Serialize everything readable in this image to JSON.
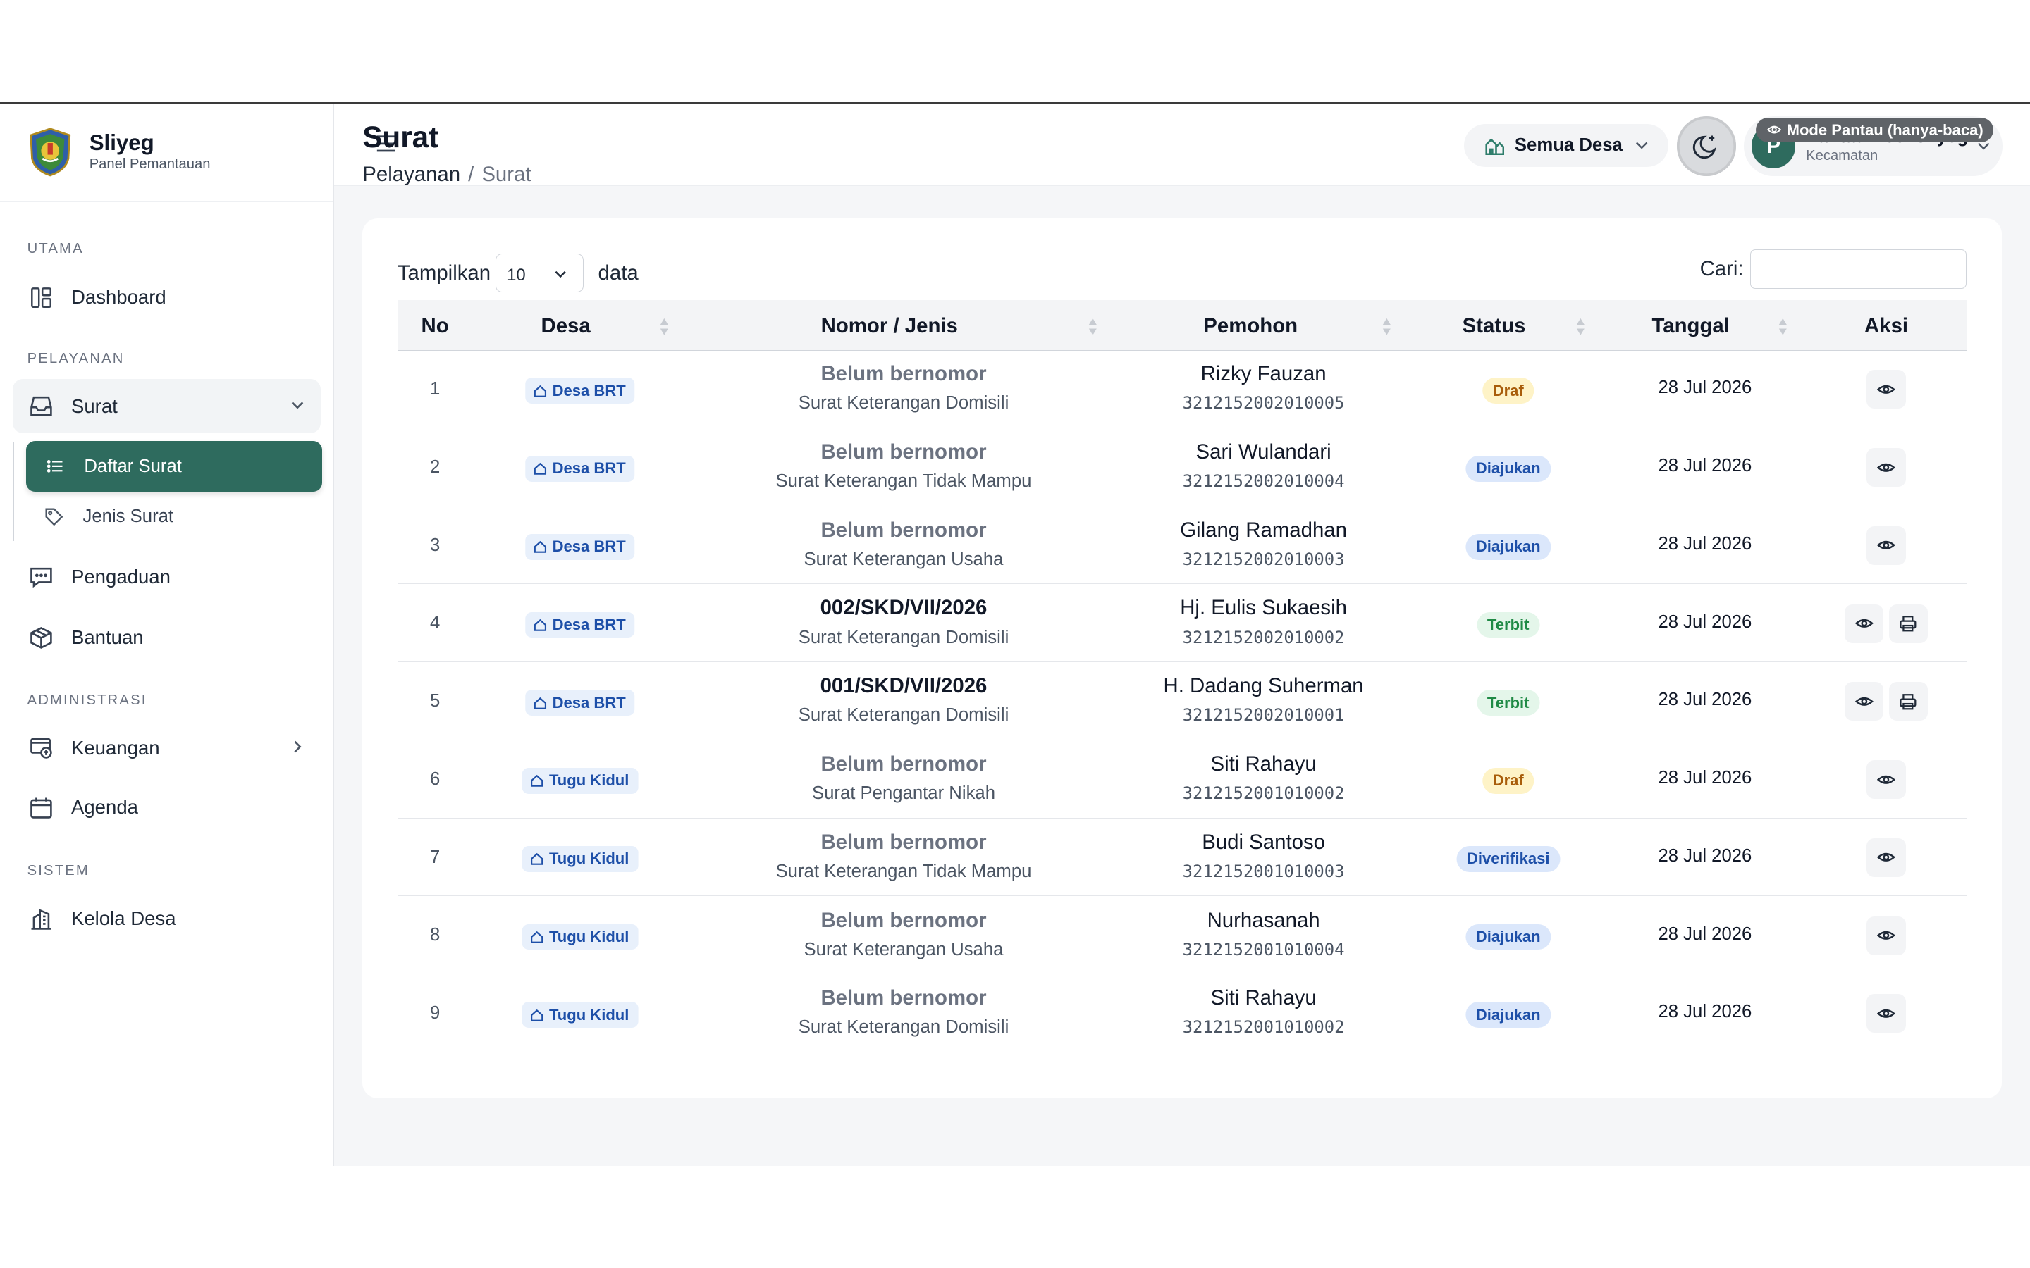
{
  "brand": {
    "name": "Sliyeg",
    "subtitle": "Panel Pemantauan"
  },
  "sidebar": {
    "sections": {
      "utama": "UTAMA",
      "pelayanan": "PELAYANAN",
      "administrasi": "ADMINISTRASI",
      "sistem": "SISTEM"
    },
    "items": {
      "dashboard": "Dashboard",
      "surat": "Surat",
      "daftar_surat": "Daftar Surat",
      "jenis_surat": "Jenis Surat",
      "pengaduan": "Pengaduan",
      "bantuan": "Bantuan",
      "keuangan": "Keuangan",
      "agenda": "Agenda",
      "kelola_desa": "Kelola Desa"
    }
  },
  "header": {
    "village_filter": "Semua Desa",
    "user": {
      "initial": "P",
      "name": "Pantau Kec. Sliyeg",
      "role": "Kecamatan"
    }
  },
  "page": {
    "title": "Surat",
    "breadcrumb": {
      "parent": "Pelayanan",
      "separator": "/",
      "current": "Surat"
    },
    "mode_badge": "Mode Pantau (hanya-baca)"
  },
  "table": {
    "show_label": "Tampilkan",
    "page_size": "10",
    "data_label": "data",
    "search_label": "Cari:",
    "search_value": "",
    "columns": [
      "No",
      "Desa",
      "Nomor / Jenis",
      "Pemohon",
      "Status",
      "Tanggal",
      "Aksi"
    ],
    "rows": [
      {
        "no": "1",
        "desa": "Desa BRT",
        "nomor": "Belum bernomor",
        "jenis": "Surat Keterangan Domisili",
        "pemohon": "Rizky Fauzan",
        "nik": "3212152002010005",
        "status": "Draf",
        "status_kind": "draf",
        "tanggal": "28 Jul 2026",
        "can_print": false
      },
      {
        "no": "2",
        "desa": "Desa BRT",
        "nomor": "Belum bernomor",
        "jenis": "Surat Keterangan Tidak Mampu",
        "pemohon": "Sari Wulandari",
        "nik": "3212152002010004",
        "status": "Diajukan",
        "status_kind": "diajukan",
        "tanggal": "28 Jul 2026",
        "can_print": false
      },
      {
        "no": "3",
        "desa": "Desa BRT",
        "nomor": "Belum bernomor",
        "jenis": "Surat Keterangan Usaha",
        "pemohon": "Gilang Ramadhan",
        "nik": "3212152002010003",
        "status": "Diajukan",
        "status_kind": "diajukan",
        "tanggal": "28 Jul 2026",
        "can_print": false
      },
      {
        "no": "4",
        "desa": "Desa BRT",
        "nomor": "002/SKD/VII/2026",
        "jenis": "Surat Keterangan Domisili",
        "pemohon": "Hj. Eulis Sukaesih",
        "nik": "3212152002010002",
        "status": "Terbit",
        "status_kind": "terbit",
        "tanggal": "28 Jul 2026",
        "can_print": true
      },
      {
        "no": "5",
        "desa": "Desa BRT",
        "nomor": "001/SKD/VII/2026",
        "jenis": "Surat Keterangan Domisili",
        "pemohon": "H. Dadang Suherman",
        "nik": "3212152002010001",
        "status": "Terbit",
        "status_kind": "terbit",
        "tanggal": "28 Jul 2026",
        "can_print": true
      },
      {
        "no": "6",
        "desa": "Tugu Kidul",
        "nomor": "Belum bernomor",
        "jenis": "Surat Pengantar Nikah",
        "pemohon": "Siti Rahayu",
        "nik": "3212152001010002",
        "status": "Draf",
        "status_kind": "draf",
        "tanggal": "28 Jul 2026",
        "can_print": false
      },
      {
        "no": "7",
        "desa": "Tugu Kidul",
        "nomor": "Belum bernomor",
        "jenis": "Surat Keterangan Tidak Mampu",
        "pemohon": "Budi Santoso",
        "nik": "3212152001010003",
        "status": "Diverifikasi",
        "status_kind": "diverifikasi",
        "tanggal": "28 Jul 2026",
        "can_print": false
      },
      {
        "no": "8",
        "desa": "Tugu Kidul",
        "nomor": "Belum bernomor",
        "jenis": "Surat Keterangan Usaha",
        "pemohon": "Nurhasanah",
        "nik": "3212152001010004",
        "status": "Diajukan",
        "status_kind": "diajukan",
        "tanggal": "28 Jul 2026",
        "can_print": false
      },
      {
        "no": "9",
        "desa": "Tugu Kidul",
        "nomor": "Belum bernomor",
        "jenis": "Surat Keterangan Domisili",
        "pemohon": "Siti Rahayu",
        "nik": "3212152001010002",
        "status": "Diajukan",
        "status_kind": "diajukan",
        "tanggal": "28 Jul 2026",
        "can_print": false
      }
    ]
  },
  "colors": {
    "primary": "#2e6b5e",
    "draf": "#fef3c7",
    "diajukan": "#dbe7fb",
    "terbit": "#e4f6ea"
  }
}
